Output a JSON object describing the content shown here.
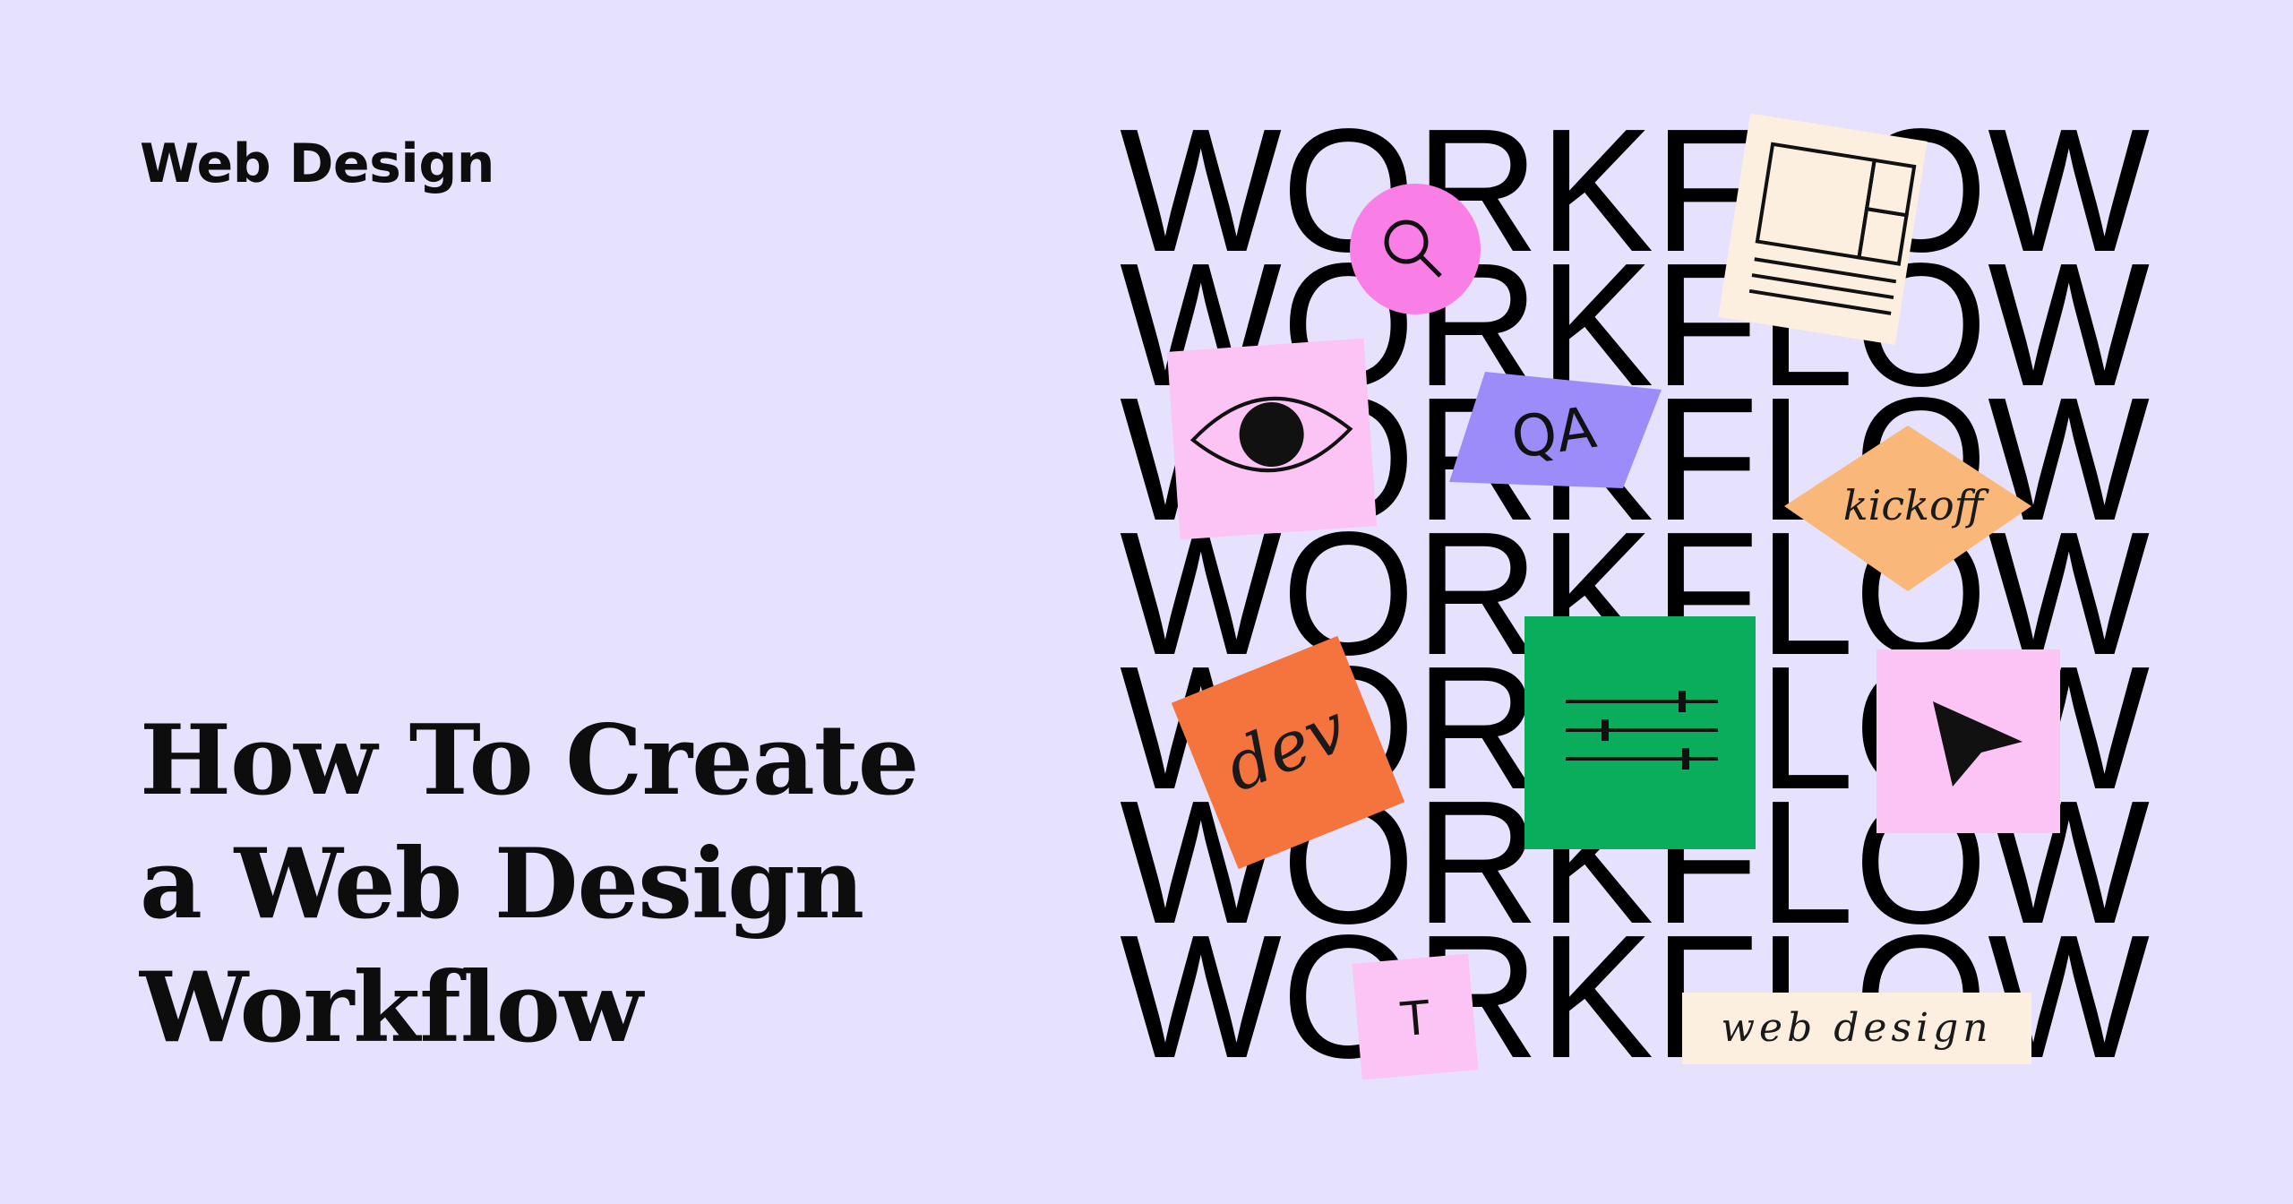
{
  "category": "Web Design",
  "headline": {
    "line1": "How To Create",
    "line2": "a Web Design",
    "line3": "Workflow"
  },
  "illustration": {
    "repeated_word": "WORKFLOW",
    "repeat_count": 7,
    "stickers": {
      "qa": "QA",
      "kickoff": "kickoff",
      "dev": "dev",
      "typography": "T",
      "web_design": "web design"
    },
    "icons": [
      "search-icon",
      "eye-icon",
      "layout-wireframe-icon",
      "sliders-icon",
      "cursor-arrow-icon"
    ]
  },
  "colors": {
    "background": "#e6e1fc",
    "pink": "#f97fe6",
    "light_pink": "#fcc4f4",
    "cream": "#fdefe0",
    "purple": "#9b8cfa",
    "peach": "#f9b87a",
    "orange": "#f5733c",
    "green": "#0aad5c",
    "text": "#0d0d0d"
  }
}
